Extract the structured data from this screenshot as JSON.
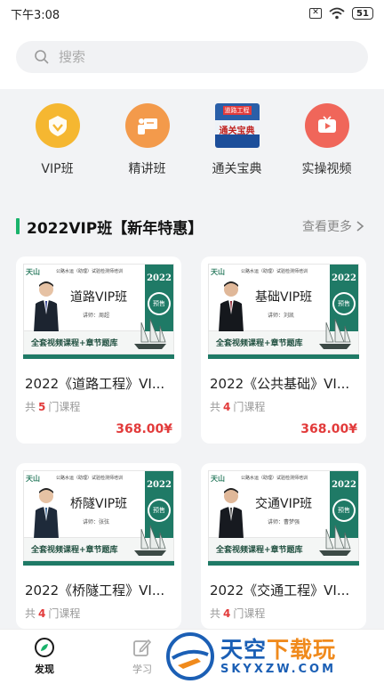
{
  "status_bar": {
    "time": "下午3:08",
    "sim_icon": "sim-x-icon",
    "battery": "51"
  },
  "search": {
    "placeholder": "搜索"
  },
  "categories": [
    {
      "label": "VIP班",
      "icon": "vip-shield-icon",
      "color": "#f5b731"
    },
    {
      "label": "精讲班",
      "icon": "lecture-board-icon",
      "color": "#f39a4b"
    },
    {
      "label": "通关宝典",
      "icon": "book-cover-icon",
      "cover_tag": "道路工程",
      "cover_title": "通关宝典"
    },
    {
      "label": "实操视频",
      "icon": "video-play-icon",
      "color": "#f0665a"
    }
  ],
  "section": {
    "title": "2022VIP班【新年特惠】",
    "more": "查看更多",
    "accent": "#19b36b"
  },
  "banner_common": {
    "logo": "天山",
    "tagline": "公路水运（助理）试验检测师培训",
    "year": "2022",
    "sale": "预售",
    "strip": "全套视频课程+章节题库"
  },
  "courses": [
    {
      "banner_name": "道路VIP班",
      "lecturer": "讲师：周超",
      "title": "2022《道路工程》VI...",
      "count_prefix": "共",
      "count": "5",
      "count_suffix": "门课程",
      "price": "368.00¥"
    },
    {
      "banner_name": "基础VIP班",
      "lecturer": "讲师：刘凯",
      "title": "2022《公共基础》VI...",
      "count_prefix": "共",
      "count": "4",
      "count_suffix": "门课程",
      "price": "368.00¥"
    },
    {
      "banner_name": "桥隧VIP班",
      "lecturer": "讲师：张弦",
      "title": "2022《桥隧工程》VI...",
      "count_prefix": "共",
      "count": "4",
      "count_suffix": "门课程",
      "price": ""
    },
    {
      "banner_name": "交通VIP班",
      "lecturer": "讲师：曹梦强",
      "title": "2022《交通工程》VI...",
      "count_prefix": "共",
      "count": "4",
      "count_suffix": "门课程",
      "price": ""
    }
  ],
  "tabs": [
    {
      "label": "发现",
      "icon": "compass-icon",
      "active": true
    },
    {
      "label": "学习",
      "icon": "edit-icon",
      "active": false
    }
  ],
  "watermark": {
    "cn_main": "天空",
    "cn_accent": "下载玩",
    "en": "SKYXZW.COM"
  }
}
